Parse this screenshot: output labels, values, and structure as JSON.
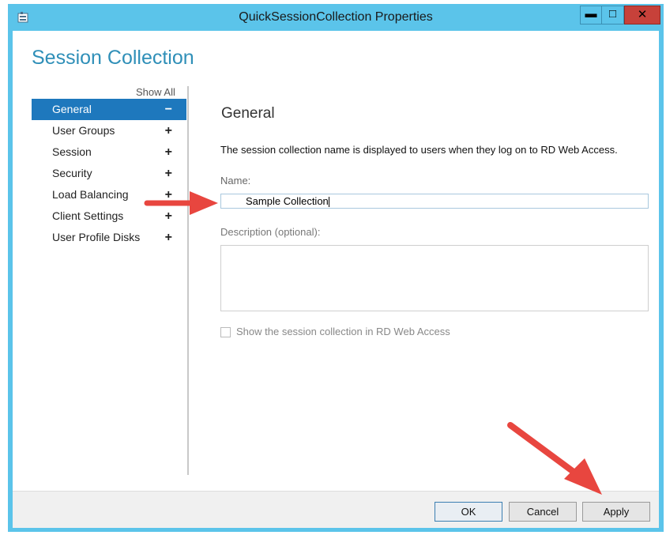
{
  "window": {
    "title": "QuickSessionCollection Properties",
    "minimize_glyph": "▬",
    "maximize_glyph": "□",
    "close_glyph": "✕",
    "accent_color": "#5bc4ea",
    "close_color": "#c7413a"
  },
  "page": {
    "heading": "Session Collection",
    "show_all": "Show All"
  },
  "nav": {
    "items": [
      {
        "label": "General",
        "sign": "−",
        "active": true
      },
      {
        "label": "User Groups",
        "sign": "+"
      },
      {
        "label": "Session",
        "sign": "+"
      },
      {
        "label": "Security",
        "sign": "+"
      },
      {
        "label": "Load Balancing",
        "sign": "+"
      },
      {
        "label": "Client Settings",
        "sign": "+"
      },
      {
        "label": "User Profile Disks",
        "sign": "+"
      }
    ],
    "active_color": "#1e78bd"
  },
  "general": {
    "title": "General",
    "description": "The session collection name is displayed to users when they log on to RD Web Access.",
    "name_label": "Name:",
    "name_value": "Sample Collection",
    "description_label": "Description (optional):",
    "description_value": "",
    "show_in_web_label": "Show the session collection in RD Web Access",
    "show_in_web_checked": false
  },
  "footer": {
    "ok": "OK",
    "cancel": "Cancel",
    "apply": "Apply"
  },
  "annotations": {
    "arrow_color": "#e8463f"
  }
}
